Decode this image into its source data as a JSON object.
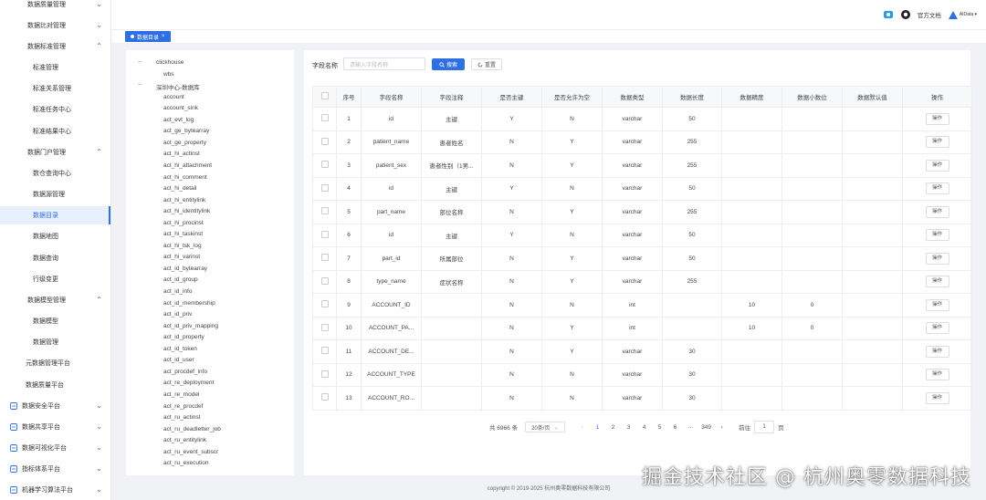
{
  "sidebar": {
    "items": [
      {
        "label": "数据质量管理",
        "chev": "⌄"
      },
      {
        "label": "数据比对管理",
        "chev": "⌄"
      },
      {
        "label": "数据标准管理",
        "chev": "⌃"
      },
      {
        "label": "标准管理"
      },
      {
        "label": "标准关系管理"
      },
      {
        "label": "标准任务中心"
      },
      {
        "label": "标准结果中心"
      },
      {
        "label": "数据门户管理",
        "chev": "⌃"
      },
      {
        "label": "数仓查询中心"
      },
      {
        "label": "数据源管理"
      },
      {
        "label": "数据目录"
      },
      {
        "label": "数据地图"
      },
      {
        "label": "数据查询"
      },
      {
        "label": "行级变更"
      },
      {
        "label": "数据模型管理",
        "chev": "⌃"
      },
      {
        "label": "数据模型"
      },
      {
        "label": "数据管理"
      },
      {
        "label": "元数据管理平台"
      },
      {
        "label": "数据质量平台"
      },
      {
        "label": "数据安全平台",
        "chev": "⌄"
      },
      {
        "label": "数据共享平台",
        "chev": "⌄"
      },
      {
        "label": "数据可视化平台",
        "chev": "⌄"
      },
      {
        "label": "指标体系平台",
        "chev": "⌄"
      },
      {
        "label": "机器学习算法平台",
        "chev": "⌄"
      }
    ]
  },
  "topbar": {
    "docs_label": "官方文档",
    "user_label": "AIData ▾"
  },
  "tab": {
    "label": "数据目录",
    "close": "×"
  },
  "tree": {
    "nodes": [
      {
        "label": "clickhouse",
        "toggle": "–"
      },
      {
        "label": "wbs"
      },
      {
        "label": "深圳中心-数据库",
        "toggle": "–"
      },
      {
        "label": "account"
      },
      {
        "label": "account_sink"
      },
      {
        "label": "act_evt_log"
      },
      {
        "label": "act_ge_bytearray"
      },
      {
        "label": "act_ge_property"
      },
      {
        "label": "act_hi_actinst"
      },
      {
        "label": "act_hi_attachment"
      },
      {
        "label": "act_hi_comment"
      },
      {
        "label": "act_hi_detail"
      },
      {
        "label": "act_hi_entitylink"
      },
      {
        "label": "act_hi_identitylink"
      },
      {
        "label": "act_hi_procinst"
      },
      {
        "label": "act_hi_taskinst"
      },
      {
        "label": "act_hi_tsk_log"
      },
      {
        "label": "act_hi_varinst"
      },
      {
        "label": "act_id_bytearray"
      },
      {
        "label": "act_id_group"
      },
      {
        "label": "act_id_info"
      },
      {
        "label": "act_id_membership"
      },
      {
        "label": "act_id_priv"
      },
      {
        "label": "act_id_priv_mapping"
      },
      {
        "label": "act_id_property"
      },
      {
        "label": "act_id_token"
      },
      {
        "label": "act_id_user"
      },
      {
        "label": "act_procdef_info"
      },
      {
        "label": "act_re_deployment"
      },
      {
        "label": "act_re_model"
      },
      {
        "label": "act_re_procdef"
      },
      {
        "label": "act_ru_actinst"
      },
      {
        "label": "act_ru_deadletter_job"
      },
      {
        "label": "act_ru_entitylink"
      },
      {
        "label": "act_ru_event_subscr"
      },
      {
        "label": "act_ru_execution"
      }
    ]
  },
  "search": {
    "label": "字段名称",
    "placeholder": "请输入字段名称",
    "search_btn": "搜索",
    "reset_btn": "重置"
  },
  "table": {
    "headers": [
      "序号",
      "字段名称",
      "字段注释",
      "是否主键",
      "是否允许为空",
      "数据类型",
      "数据长度",
      "数据精度",
      "数据小数位",
      "数据默认值",
      "操作"
    ],
    "op_label": "操作",
    "rows": [
      [
        "1",
        "id",
        "主键",
        "Y",
        "N",
        "varchar",
        "50",
        "",
        "",
        ""
      ],
      [
        "2",
        "patient_name",
        "患者姓名",
        "N",
        "Y",
        "varchar",
        "255",
        "",
        "",
        ""
      ],
      [
        "3",
        "patient_sex",
        "患者性别（1男...",
        "N",
        "Y",
        "varchar",
        "255",
        "",
        "",
        ""
      ],
      [
        "4",
        "id",
        "主键",
        "Y",
        "N",
        "varchar",
        "50",
        "",
        "",
        ""
      ],
      [
        "5",
        "part_name",
        "部位名称",
        "N",
        "Y",
        "varchar",
        "255",
        "",
        "",
        ""
      ],
      [
        "6",
        "id",
        "主键",
        "Y",
        "N",
        "varchar",
        "50",
        "",
        "",
        ""
      ],
      [
        "7",
        "part_id",
        "所属部位",
        "N",
        "Y",
        "varchar",
        "50",
        "",
        "",
        ""
      ],
      [
        "8",
        "type_name",
        "症状名称",
        "N",
        "Y",
        "varchar",
        "255",
        "",
        "",
        ""
      ],
      [
        "9",
        "ACCOUNT_ID",
        "",
        "N",
        "N",
        "int",
        "",
        "10",
        "0",
        ""
      ],
      [
        "10",
        "ACCOUNT_PA...",
        "",
        "N",
        "Y",
        "int",
        "",
        "10",
        "0",
        ""
      ],
      [
        "11",
        "ACCOUNT_DE...",
        "",
        "N",
        "Y",
        "varchar",
        "30",
        "",
        "",
        ""
      ],
      [
        "12",
        "ACCOUNT_TYPE",
        "",
        "N",
        "N",
        "varchar",
        "30",
        "",
        "",
        ""
      ],
      [
        "13",
        "ACCOUNT_RO...",
        "",
        "N",
        "N",
        "varchar",
        "30",
        "",
        "",
        ""
      ]
    ]
  },
  "pager": {
    "total": "共 6966 条",
    "size": "20条/页",
    "pages": [
      "1",
      "2",
      "3",
      "4",
      "5",
      "6",
      "···",
      "349"
    ],
    "active": "1",
    "goto_label": "前往",
    "goto_value": "1",
    "page_unit": "页",
    "prev": "‹",
    "next": "›"
  },
  "footer": {
    "copyright": "copyright © 2019-2025 杭州奥零数据科技有限公司"
  },
  "watermark": "掘金技术社区 @ 杭州奥零数据科技",
  "colors": {
    "accent": "#2f6fe4"
  }
}
